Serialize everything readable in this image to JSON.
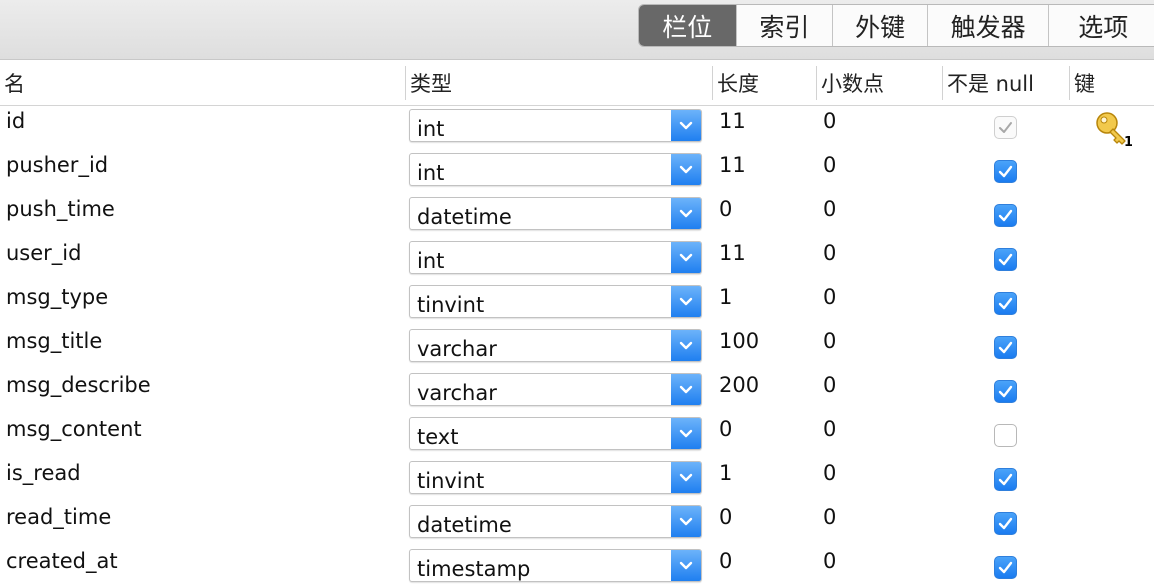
{
  "tabs": [
    {
      "label": "栏位",
      "active": true
    },
    {
      "label": "索引",
      "active": false
    },
    {
      "label": "外键",
      "active": false
    },
    {
      "label": "触发器",
      "active": false
    },
    {
      "label": "选项",
      "active": false
    }
  ],
  "columns_header": {
    "name": "名",
    "type": "类型",
    "length": "长度",
    "decimals": "小数点",
    "not_null": "不是 null",
    "key": "键"
  },
  "fields": [
    {
      "name": "id",
      "type": "int",
      "length": "11",
      "decimals": "0",
      "not_null": "disabled-checked",
      "key": "primary-key-1"
    },
    {
      "name": "pusher_id",
      "type": "int",
      "length": "11",
      "decimals": "0",
      "not_null": "checked",
      "key": ""
    },
    {
      "name": "push_time",
      "type": "datetime",
      "length": "0",
      "decimals": "0",
      "not_null": "checked",
      "key": ""
    },
    {
      "name": "user_id",
      "type": "int",
      "length": "11",
      "decimals": "0",
      "not_null": "checked",
      "key": ""
    },
    {
      "name": "msg_type",
      "type": "tinvint",
      "length": "1",
      "decimals": "0",
      "not_null": "checked",
      "key": ""
    },
    {
      "name": "msg_title",
      "type": "varchar",
      "length": "100",
      "decimals": "0",
      "not_null": "checked",
      "key": ""
    },
    {
      "name": "msg_describe",
      "type": "varchar",
      "length": "200",
      "decimals": "0",
      "not_null": "checked",
      "key": ""
    },
    {
      "name": "msg_content",
      "type": "text",
      "length": "0",
      "decimals": "0",
      "not_null": "unchecked",
      "key": ""
    },
    {
      "name": "is_read",
      "type": "tinvint",
      "length": "1",
      "decimals": "0",
      "not_null": "checked",
      "key": ""
    },
    {
      "name": "read_time",
      "type": "datetime",
      "length": "0",
      "decimals": "0",
      "not_null": "checked",
      "key": ""
    },
    {
      "name": "created_at",
      "type": "timestamp",
      "length": "0",
      "decimals": "0",
      "not_null": "checked",
      "key": ""
    }
  ],
  "colors": {
    "active_tab": "#686868",
    "accent_blue": "#1f7ff0",
    "key_gold": "#e8b63a"
  },
  "icons": {
    "select_arrow": "chevron-down-icon",
    "check": "checkmark-icon",
    "key": "key-icon"
  }
}
